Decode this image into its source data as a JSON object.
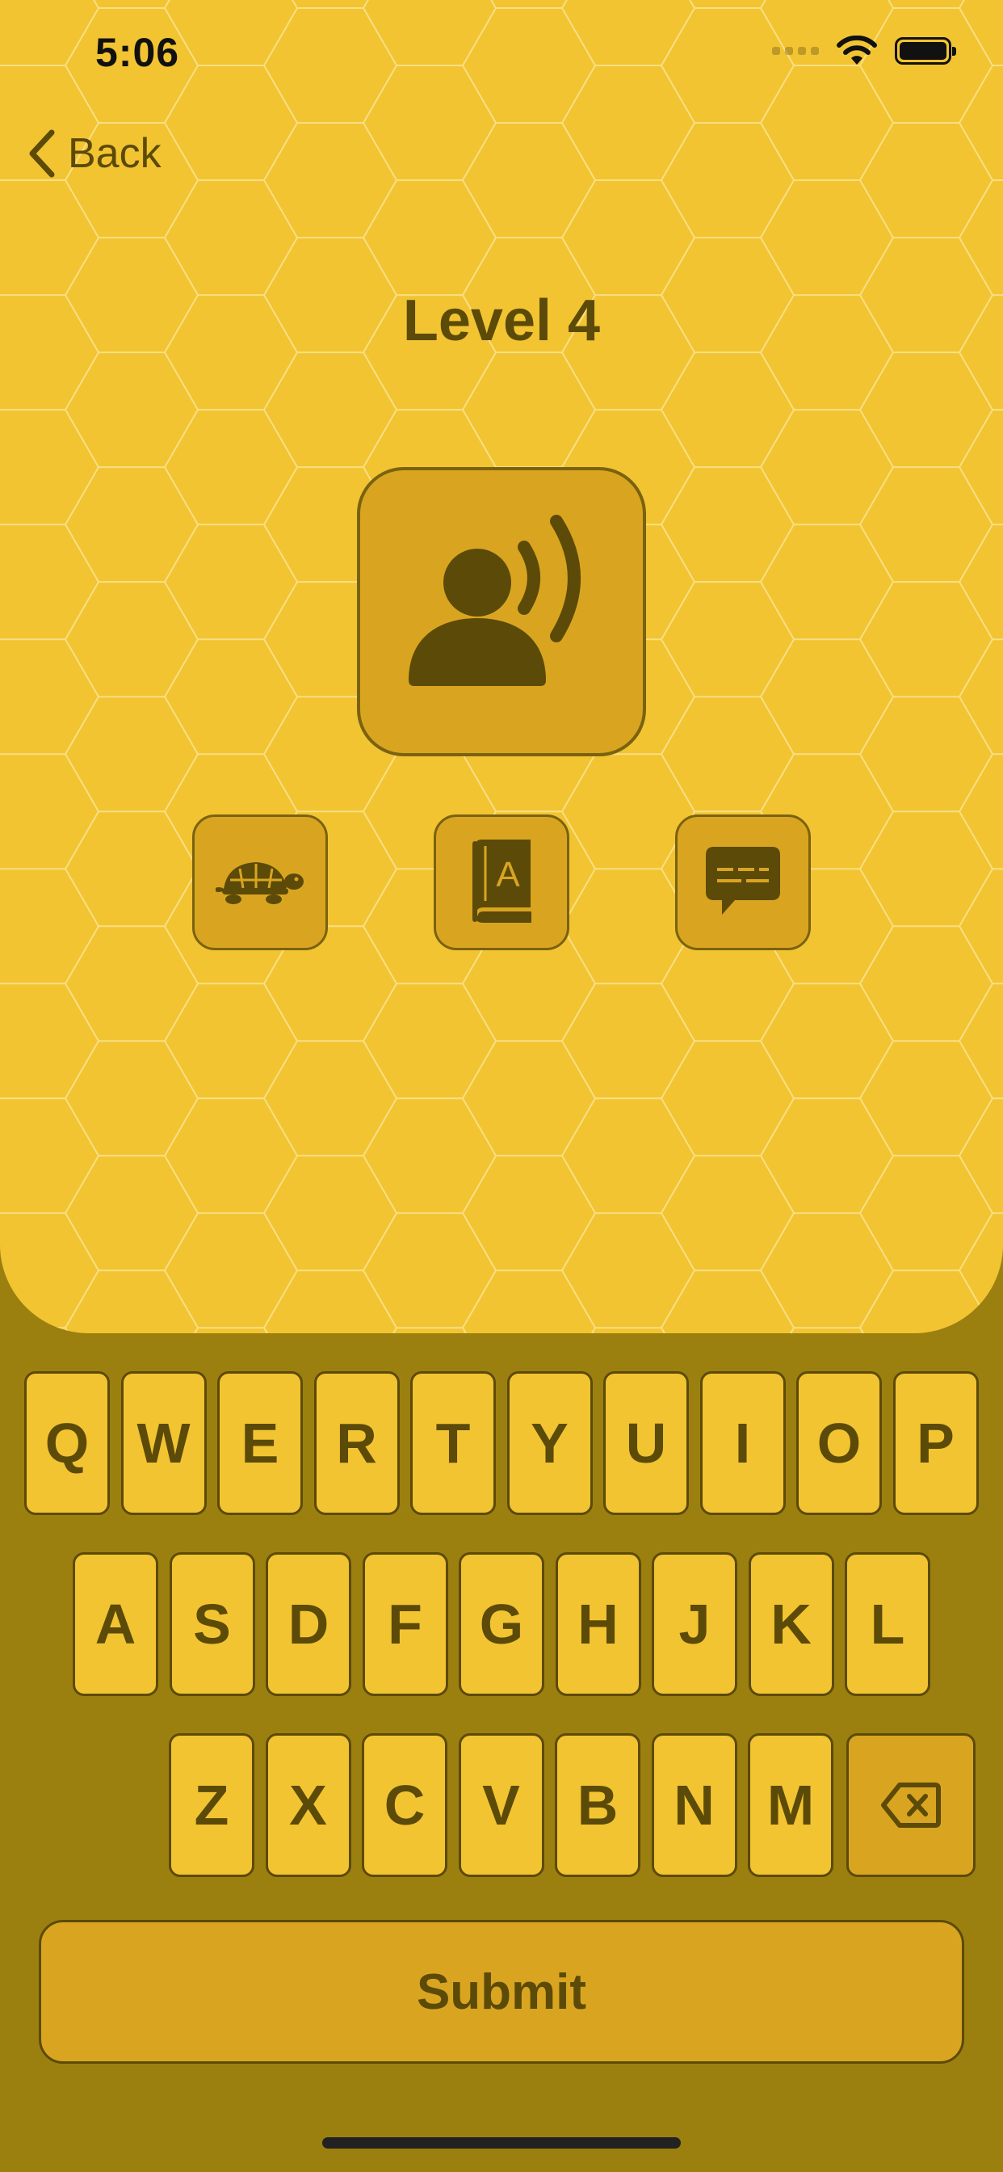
{
  "status_bar": {
    "time": "5:06"
  },
  "nav": {
    "back_label": "Back"
  },
  "level": {
    "title": "Level 4"
  },
  "controls": {
    "speak_icon": "person-speaking-icon",
    "slow_icon": "tortoise-icon",
    "dictionary_icon": "dictionary-book-icon",
    "caption_icon": "caption-bubble-icon"
  },
  "keyboard": {
    "row1": [
      "Q",
      "W",
      "E",
      "R",
      "T",
      "Y",
      "U",
      "I",
      "O",
      "P"
    ],
    "row2": [
      "A",
      "S",
      "D",
      "F",
      "G",
      "H",
      "J",
      "K",
      "L"
    ],
    "row3": [
      "Z",
      "X",
      "C",
      "V",
      "B",
      "N",
      "M"
    ],
    "delete_icon": "backspace-icon"
  },
  "submit_label": "Submit",
  "colors": {
    "background": "#f2c432",
    "keyboard_area": "#9b8010",
    "tile": "#d9a520",
    "ink": "#5c4a08"
  }
}
